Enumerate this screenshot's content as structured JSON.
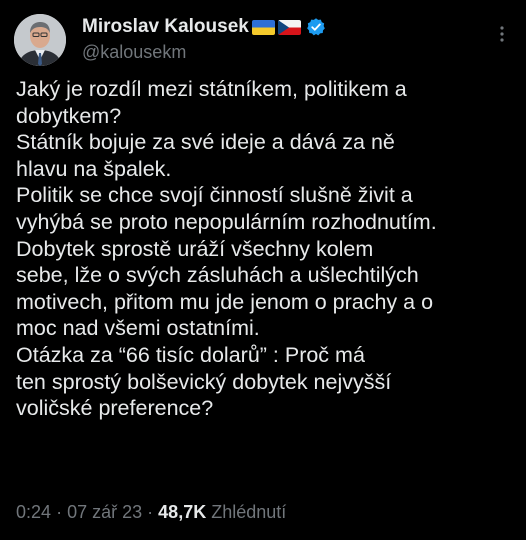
{
  "header": {
    "display_name": "Miroslav Kalousek",
    "handle": "@kalousekm",
    "flags": [
      "ukraine-flag",
      "czech-flag"
    ],
    "verified_icon": "verified-badge-icon",
    "menu_icon": "more-vertical-icon"
  },
  "post": {
    "lines": [
      "Jaký je rozdíl mezi státníkem, politikem a",
      "dobytkem?",
      "Státník bojuje za své ideje a dává za ně",
      "hlavu na špalek.",
      "Politik se chce svojí činností slušně živit a",
      "vyhýbá se proto nepopulárním rozhodnutím.",
      "Dobytek sprostě uráží všechny kolem",
      "sebe, lže o svých zásluhách a ušlechtilých",
      "motivech, přitom mu jde jenom o prachy a o",
      "moc nad všemi ostatními.",
      "Otázka za “66 tisíc dolarů” : Proč má",
      "ten sprostý bolševický dobytek nejvyšší",
      "voličské preference?"
    ]
  },
  "meta": {
    "time": "0:24",
    "separator": "·",
    "date": "07 zář 23",
    "views_count": "48,7K",
    "views_label": "Zhlédnutí"
  },
  "colors": {
    "background": "#000000",
    "text_primary": "#e7e9ea",
    "text_secondary": "#71767b",
    "verified": "#1d9bf0"
  }
}
